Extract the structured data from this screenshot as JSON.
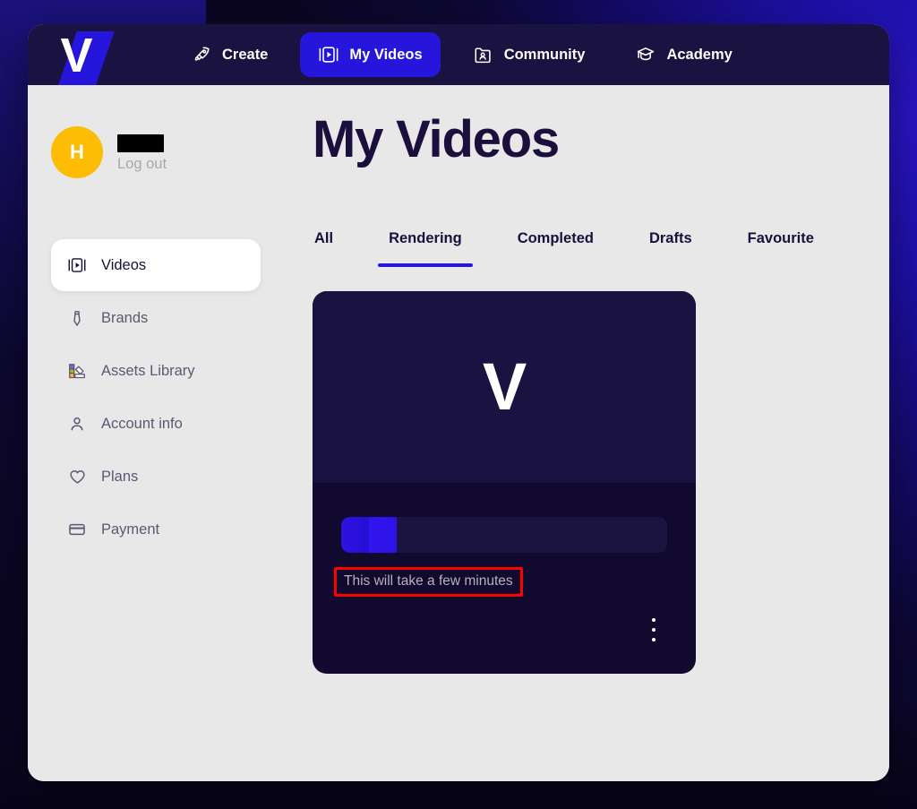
{
  "nav": {
    "logo_letter": "V",
    "items": [
      {
        "label": "Create",
        "icon": "rocket-icon",
        "active": false
      },
      {
        "label": "My Videos",
        "icon": "video-icon",
        "active": true
      },
      {
        "label": "Community",
        "icon": "community-icon",
        "active": false
      },
      {
        "label": "Academy",
        "icon": "academy-icon",
        "active": false
      }
    ]
  },
  "user": {
    "avatar_initial": "H",
    "name_redacted": true,
    "logout_label": "Log out"
  },
  "sidebar": {
    "items": [
      {
        "label": "Videos",
        "icon": "video-icon",
        "active": true
      },
      {
        "label": "Brands",
        "icon": "tie-icon",
        "active": false
      },
      {
        "label": "Assets Library",
        "icon": "assets-icon",
        "active": false
      },
      {
        "label": "Account info",
        "icon": "person-icon",
        "active": false
      },
      {
        "label": "Plans",
        "icon": "heart-icon",
        "active": false
      },
      {
        "label": "Payment",
        "icon": "card-icon",
        "active": false
      }
    ]
  },
  "main": {
    "title": "My Videos",
    "tabs": [
      {
        "label": "All",
        "active": false
      },
      {
        "label": "Rendering",
        "active": true
      },
      {
        "label": "Completed",
        "active": false
      },
      {
        "label": "Drafts",
        "active": false
      },
      {
        "label": "Favourite",
        "active": false
      }
    ],
    "video_card": {
      "thumbnail_letter": "V",
      "progress_percent": 17,
      "status_text": "This will take a few minutes",
      "status_highlighted": true,
      "menu_icon": "more-vertical-icon"
    }
  },
  "colors": {
    "accent_blue": "#2616dc",
    "nav_background": "#1a1240",
    "page_background": "#e8e8e8",
    "card_background": "#120a2e",
    "card_thumb_background": "#1a1240",
    "avatar_yellow": "#ffbc04",
    "annotation_red": "#ff0000",
    "title_color": "#1a0f3d",
    "sidebar_text": "#5b5873"
  }
}
